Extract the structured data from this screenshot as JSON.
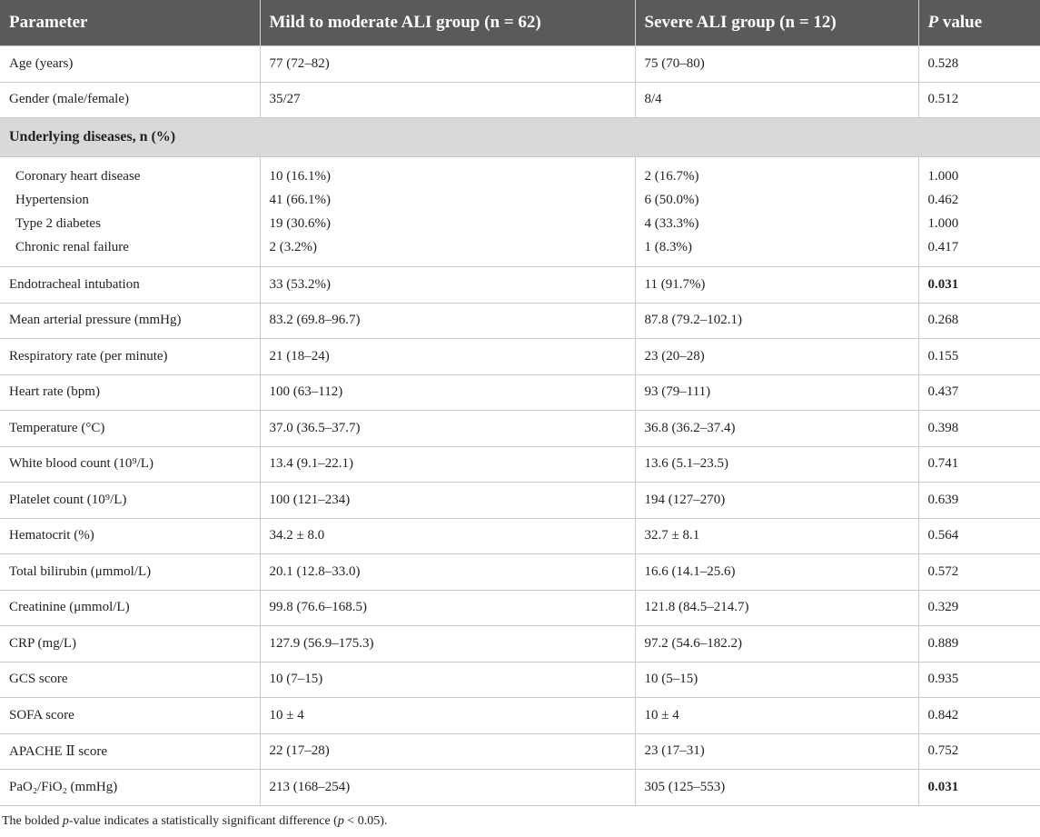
{
  "header": {
    "parameter": "Parameter",
    "mild": "Mild to moderate ALI group (n = 62)",
    "severe": "Severe ALI group (n = 12)",
    "p_italic": "P",
    "p_rest": " value"
  },
  "rows_top": [
    {
      "param": "Age (years)",
      "mild": "77 (72–82)",
      "severe": "75 (70–80)",
      "p": "0.528"
    },
    {
      "param": "Gender (male/female)",
      "mild": "35/27",
      "severe": "8/4",
      "p": "0.512"
    }
  ],
  "section": "Underlying diseases, n (%)",
  "diseases": [
    {
      "param": "Coronary heart disease",
      "mild": "10 (16.1%)",
      "severe": "2 (16.7%)",
      "p": "1.000"
    },
    {
      "param": "Hypertension",
      "mild": "41 (66.1%)",
      "severe": "6 (50.0%)",
      "p": "0.462"
    },
    {
      "param": "Type 2 diabetes",
      "mild": "19 (30.6%)",
      "severe": "4 (33.3%)",
      "p": "1.000"
    },
    {
      "param": "Chronic renal failure",
      "mild": "2 (3.2%)",
      "severe": "1 (8.3%)",
      "p": "0.417"
    }
  ],
  "rows_bottom": [
    {
      "param": "Endotracheal intubation",
      "mild": "33 (53.2%)",
      "severe": "11 (91.7%)",
      "p": "0.031",
      "bold": true
    },
    {
      "param": "Mean arterial pressure (mmHg)",
      "mild": "83.2 (69.8–96.7)",
      "severe": "87.8 (79.2–102.1)",
      "p": "0.268"
    },
    {
      "param": "Respiratory rate (per minute)",
      "mild": "21 (18–24)",
      "severe": "23 (20–28)",
      "p": "0.155"
    },
    {
      "param": "Heart rate (bpm)",
      "mild": "100 (63–112)",
      "severe": "93 (79–111)",
      "p": "0.437"
    },
    {
      "param": "Temperature (°C)",
      "mild": "37.0 (36.5–37.7)",
      "severe": "36.8 (36.2–37.4)",
      "p": "0.398"
    },
    {
      "param": "White blood count (10⁹/L)",
      "mild": "13.4 (9.1–22.1)",
      "severe": "13.6 (5.1–23.5)",
      "p": "0.741"
    },
    {
      "param": "Platelet count (10⁹/L)",
      "mild": "100 (121–234)",
      "severe": "194 (127–270)",
      "p": "0.639"
    },
    {
      "param": "Hematocrit (%)",
      "mild": "34.2 ± 8.0",
      "severe": "32.7 ± 8.1",
      "p": "0.564"
    },
    {
      "param": "Total bilirubin (μmmol/L)",
      "mild": "20.1 (12.8–33.0)",
      "severe": "16.6 (14.1–25.6)",
      "p": "0.572"
    },
    {
      "param": "Creatinine (μmmol/L)",
      "mild": "99.8 (76.6–168.5)",
      "severe": "121.8 (84.5–214.7)",
      "p": "0.329"
    },
    {
      "param": "CRP (mg/L)",
      "mild": "127.9 (56.9–175.3)",
      "severe": "97.2 (54.6–182.2)",
      "p": "0.889"
    },
    {
      "param": "GCS score",
      "mild": "10 (7–15)",
      "severe": "10 (5–15)",
      "p": "0.935"
    },
    {
      "param": "SOFA score",
      "mild": "10 ± 4",
      "severe": "10 ± 4",
      "p": "0.842"
    },
    {
      "param": "APACHE Ⅱ score",
      "mild": "22 (17–28)",
      "severe": "23 (17–31)",
      "p": "0.752"
    },
    {
      "param": "PaO₂/FiO₂ (mmHg)",
      "mild": "213 (168–254)",
      "severe": "305 (125–553)",
      "p": "0.031",
      "bold": true
    }
  ],
  "footnote": {
    "pre": "The bolded ",
    "p_italic": "p",
    "mid": "-value indicates a statistically significant difference (",
    "p2_italic": "p",
    "post": " < 0.05)."
  }
}
